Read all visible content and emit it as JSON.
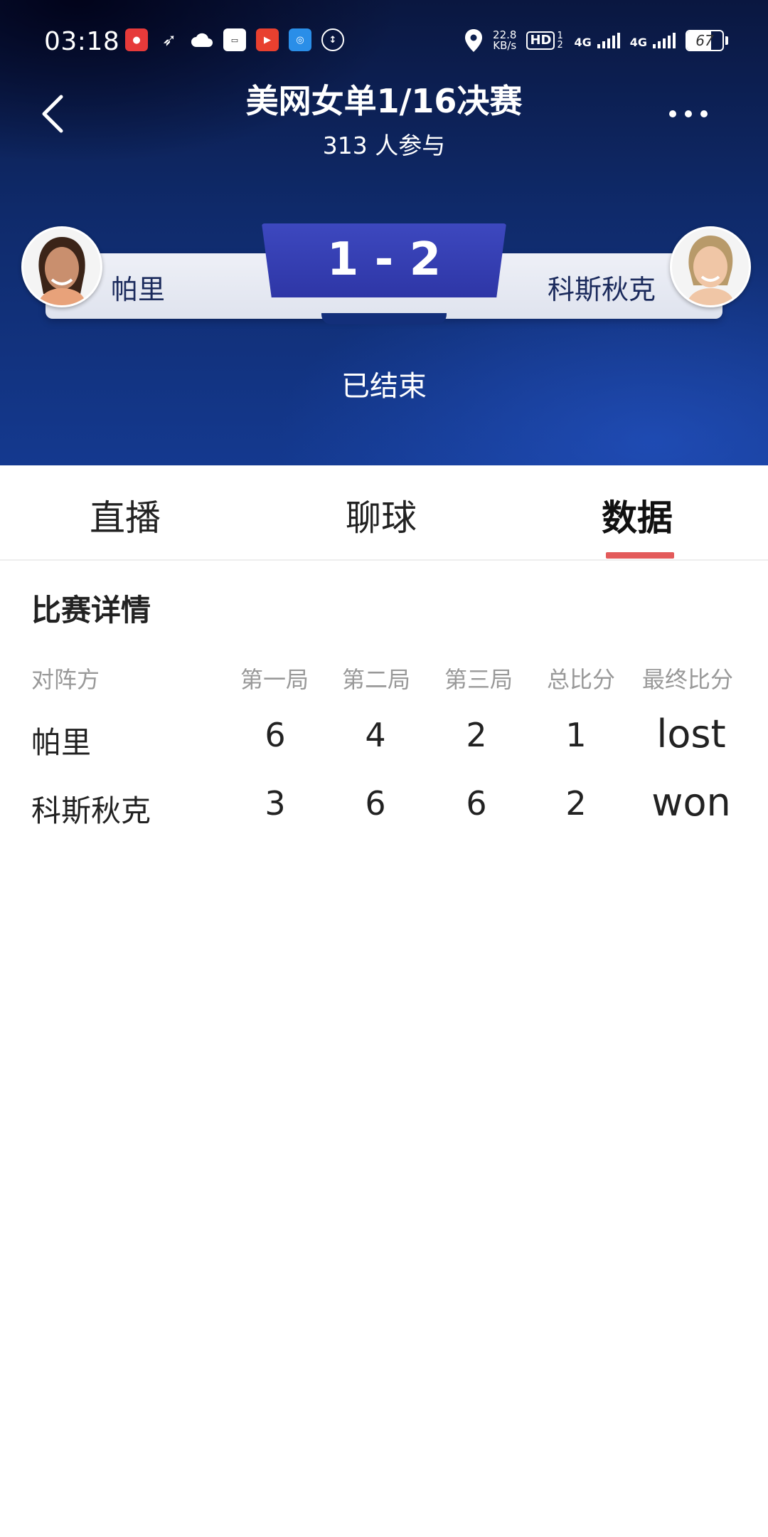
{
  "status_bar": {
    "time": "03:18",
    "net_speed_value": "22.8",
    "net_speed_unit": "KB/s",
    "hd_label": "HD",
    "hd_sub": "1 2",
    "signal_1": "4G",
    "signal_2": "4G",
    "battery": "67"
  },
  "header": {
    "title": "美网女单1/16决赛",
    "participants": "313 人参与"
  },
  "match": {
    "player_left": "帕里",
    "player_right": "科斯秋克",
    "score": "1 - 2",
    "status": "已结束"
  },
  "tabs": [
    {
      "label": "直播"
    },
    {
      "label": "聊球"
    },
    {
      "label": "数据"
    }
  ],
  "active_tab": "数据",
  "details": {
    "title": "比赛详情",
    "headers": [
      "对阵方",
      "第一局",
      "第二局",
      "第三局",
      "总比分",
      "最终比分"
    ],
    "rows": [
      {
        "name": "帕里",
        "set1": "6",
        "set2": "4",
        "set3": "2",
        "total": "1",
        "final": "lost"
      },
      {
        "name": "科斯秋克",
        "set1": "3",
        "set2": "6",
        "set3": "6",
        "total": "2",
        "final": "won"
      }
    ]
  },
  "colors": {
    "hero_dark": "#0a1740",
    "hero_mid": "#14398f",
    "score_box": "#2e36a6",
    "tab_indicator": "#e35a5a"
  }
}
